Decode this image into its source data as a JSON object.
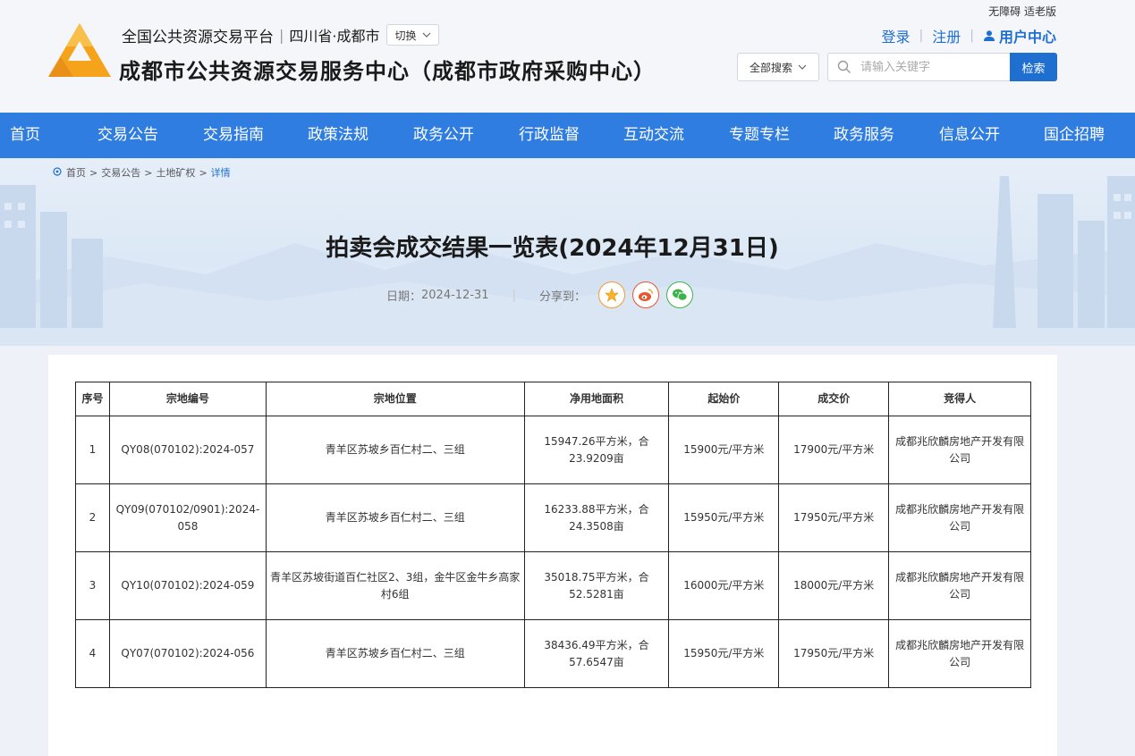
{
  "header": {
    "accessibility": "无障碍 适老版",
    "platform_name": "全国公共资源交易平台",
    "region": "四川省·成都市",
    "switch_label": "切换",
    "site_title": "成都市公共资源交易服务中心（成都市政府采购中心）",
    "login": "登录",
    "register": "注册",
    "user_center": "用户中心",
    "search_scope": "全部搜索",
    "search_placeholder": "请输入关键字",
    "search_button": "检索"
  },
  "nav": {
    "items": [
      "首页",
      "交易公告",
      "交易指南",
      "政策法规",
      "政务公开",
      "行政监督",
      "互动交流",
      "专题专栏",
      "政务服务",
      "信息公开",
      "国企招聘"
    ]
  },
  "breadcrumb": {
    "home": "首页",
    "sep": ">",
    "level1": "交易公告",
    "level2": "土地矿权",
    "current": "详情"
  },
  "article": {
    "title": "拍卖会成交结果一览表(2024年12月31日)",
    "date_label": "日期：",
    "date": "2024-12-31",
    "divider": "|",
    "share_label": "分享到："
  },
  "table": {
    "headers": [
      "序号",
      "宗地编号",
      "宗地位置",
      "净用地面积",
      "起始价",
      "成交价",
      "竞得人"
    ],
    "rows": [
      {
        "no": "1",
        "code": "QY08(070102):2024-057",
        "location": "青羊区苏坡乡百仁村二、三组",
        "area": "15947.26平方米，合23.9209亩",
        "start_price": "15900元/平方米",
        "deal_price": "17900元/平方米",
        "winner": "成都兆欣麟房地产开发有限公司"
      },
      {
        "no": "2",
        "code": "QY09(070102/0901):2024-058",
        "location": "青羊区苏坡乡百仁村二、三组",
        "area": "16233.88平方米，合24.3508亩",
        "start_price": "15950元/平方米",
        "deal_price": "17950元/平方米",
        "winner": "成都兆欣麟房地产开发有限公司"
      },
      {
        "no": "3",
        "code": "QY10(070102):2024-059",
        "location": "青羊区苏坡街道百仁社区2、3组，金牛区金牛乡高家村6组",
        "area": "35018.75平方米，合52.5281亩",
        "start_price": "16000元/平方米",
        "deal_price": "18000元/平方米",
        "winner": "成都兆欣麟房地产开发有限公司"
      },
      {
        "no": "4",
        "code": "QY07(070102):2024-056",
        "location": "青羊区苏坡乡百仁村二、三组",
        "area": "38436.49平方米，合57.6547亩",
        "start_price": "15950元/平方米",
        "deal_price": "17950元/平方米",
        "winner": "成都兆欣麟房地产开发有限公司"
      }
    ]
  },
  "colors": {
    "brand_blue": "#2f7de1",
    "link_blue": "#1f6fd1",
    "logo_orange": "#f5a31a"
  }
}
